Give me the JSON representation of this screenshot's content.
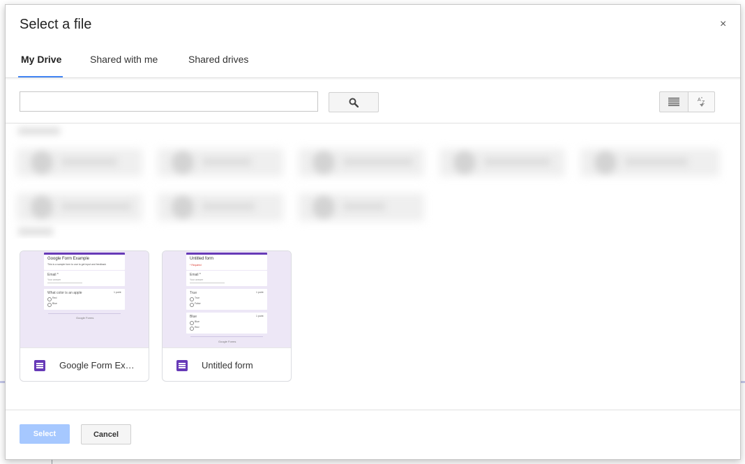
{
  "dialog": {
    "title": "Select a file",
    "close_label": "×"
  },
  "tabs": [
    {
      "label": "My Drive",
      "active": true
    },
    {
      "label": "Shared with me",
      "active": false
    },
    {
      "label": "Shared drives",
      "active": false
    }
  ],
  "search": {
    "value": "",
    "placeholder": "",
    "button_icon": "search-icon"
  },
  "view_controls": {
    "list_view_icon": "list-view-icon",
    "sort_label": "A Z"
  },
  "files": [
    {
      "name": "Google Form Example",
      "display_name": "Google Form Exa…",
      "icon": "google-forms-icon",
      "preview": {
        "title": "Google Form Example",
        "description": "This is a sample form to use to get input and feedback",
        "q1": "Email *",
        "q1_hint": "Your answer",
        "q2": "What color is an apple",
        "q2_points": "1 point",
        "q2_opt1": "Red",
        "q2_opt2": "Blue",
        "footer": "Google Forms"
      }
    },
    {
      "name": "Untitled form",
      "display_name": "Untitled form",
      "icon": "google-forms-icon",
      "preview": {
        "title": "Untitled form",
        "required_note": "* Required",
        "q1": "Email *",
        "q1_hint": "Your answer",
        "q2": "True",
        "q2_points": "1 point",
        "q2_opt1": "True",
        "q2_opt2": "False",
        "q3": "Blue",
        "q3_points": "1 point",
        "q3_opt1": "Blue",
        "q3_opt2": "Red",
        "footer": "Google Forms"
      }
    }
  ],
  "footer": {
    "select_label": "Select",
    "cancel_label": "Cancel"
  },
  "colors": {
    "accent": "#4285f4",
    "forms_purple": "#673ab7",
    "select_disabled": "#a6c8ff"
  }
}
